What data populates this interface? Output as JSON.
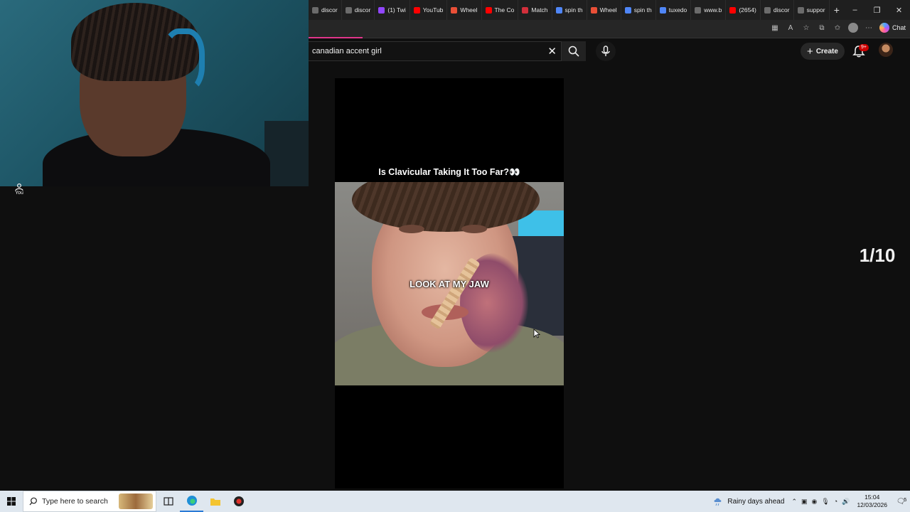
{
  "browser": {
    "tabs": [
      {
        "label": "discor",
        "color": "#6b6b6b"
      },
      {
        "label": "discor",
        "color": "#6b6b6b"
      },
      {
        "label": "(1) Twi",
        "color": "#9146ff"
      },
      {
        "label": "YouTub",
        "color": "#ff0000"
      },
      {
        "label": "Wheel",
        "color": "#e94f37"
      },
      {
        "label": "The Co",
        "color": "#ff0000"
      },
      {
        "label": "Match",
        "color": "#d22f3b"
      },
      {
        "label": "spin th",
        "color": "#4f86f7"
      },
      {
        "label": "Wheel",
        "color": "#e94f37"
      },
      {
        "label": "spin th",
        "color": "#4f86f7"
      },
      {
        "label": "tuxedo",
        "color": "#4f86f7"
      },
      {
        "label": "www.b",
        "color": "#6b6b6b"
      },
      {
        "label": "(2654)",
        "color": "#ff0000"
      },
      {
        "label": "discor",
        "color": "#6b6b6b"
      },
      {
        "label": "suppor",
        "color": "#6b6b6b"
      }
    ],
    "new_tab_symbol": "+",
    "window_controls": [
      "–",
      "❐",
      "✕"
    ],
    "chat_label": "Chat"
  },
  "youtube": {
    "search": {
      "value": "canadian accent girl",
      "clear_symbol": "✕"
    },
    "create_label": "Create",
    "notifications_badge": "9+",
    "sidebar_you_label": "You",
    "short": {
      "caption": "Is Clavicular Taking It Too Far?👀",
      "overlay_text": "LOOK AT MY JAW"
    },
    "counter": "1/10"
  },
  "taskbar": {
    "search_placeholder": "Type here to search",
    "weather": "Rainy days ahead",
    "time": "15:04",
    "date": "12/03/2026",
    "notification_count": "5"
  },
  "colors": {
    "accent_progress": "#e0358a",
    "badge_red": "#cc0000",
    "taskbar_bg": "#dfe7ef"
  }
}
